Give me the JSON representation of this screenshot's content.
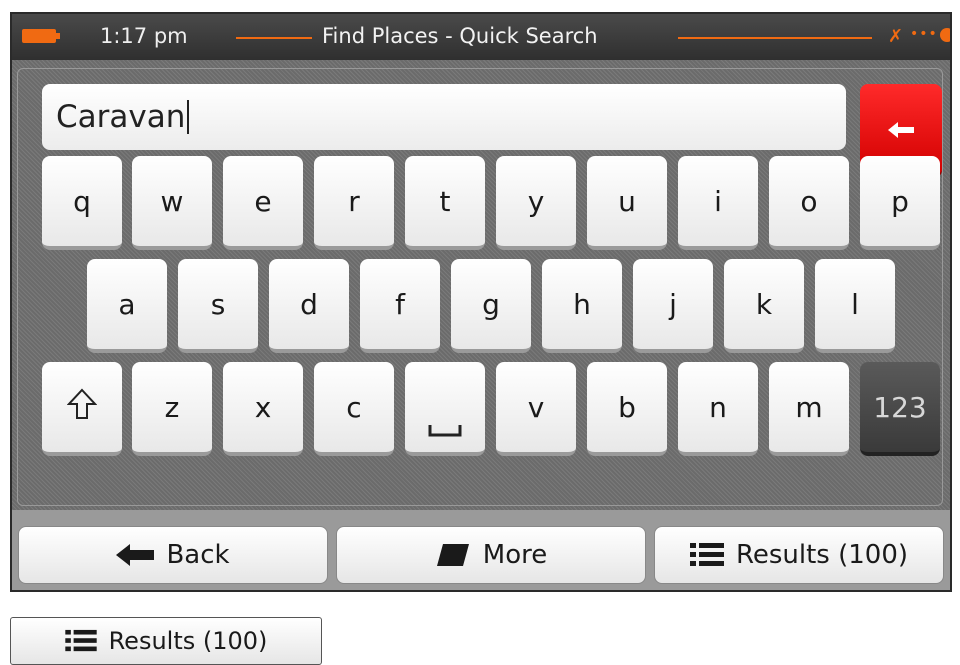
{
  "status": {
    "time": "1:17 pm",
    "title": "Find Places - Quick Search",
    "accent_color": "#f06a12"
  },
  "search": {
    "value": "Caravan",
    "clear_icon": "backspace-arrow-icon"
  },
  "keyboard": {
    "row1": [
      "q",
      "w",
      "e",
      "r",
      "t",
      "y",
      "u",
      "i",
      "o",
      "p"
    ],
    "row2": [
      "a",
      "s",
      "d",
      "f",
      "g",
      "h",
      "j",
      "k",
      "l"
    ],
    "row3": [
      "z",
      "x",
      "c",
      "v",
      "b",
      "n",
      "m"
    ],
    "shift_icon": "shift-arrow-icon",
    "space_icon": "space-bar-icon",
    "numbers_label": "123"
  },
  "bottom": {
    "back_label": "Back",
    "more_label": "More",
    "results_label": "Results (100)"
  },
  "results_copy": {
    "label": "Results (100)"
  }
}
